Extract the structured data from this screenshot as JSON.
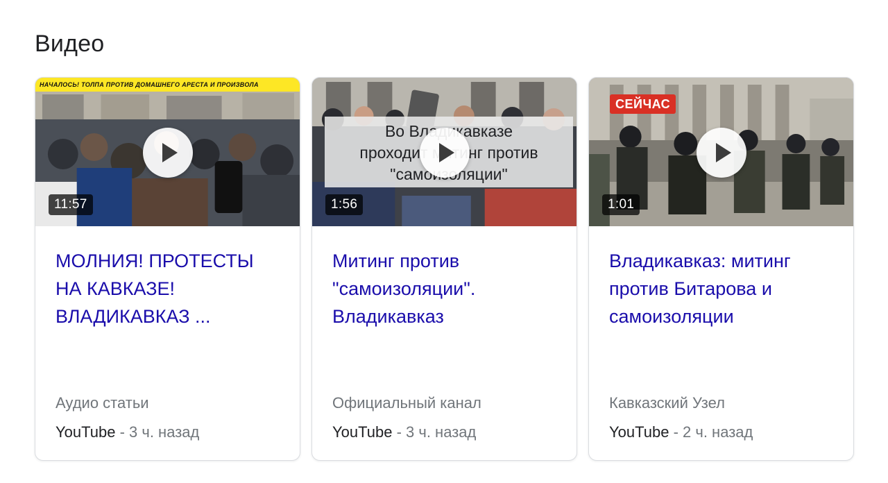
{
  "section": {
    "title": "Видео"
  },
  "videos": [
    {
      "duration": "11:57",
      "banner_text": "НАЧАЛОСЬ! ТОЛПА ПРОТИВ ДОМАШНЕГО АРЕСТА И ПРОИЗВОЛА",
      "title_lines": [
        "МОЛНИЯ! ПРОТЕСТЫ",
        "НА КАВКАЗЕ!",
        "ВЛАДИКАВКАЗ ..."
      ],
      "source": "Аудио статьи",
      "platform": "YouTube",
      "separator": " - ",
      "age": "3 ч. назад"
    },
    {
      "duration": "1:56",
      "overlay_lines": [
        "Во Владикавказе",
        "проходит митинг против",
        "\"самоизоляции\""
      ],
      "title_lines": [
        "Митинг против",
        "\"самоизоляции\".",
        "Владикавказ"
      ],
      "source": "Официальный канал",
      "platform": "YouTube",
      "separator": " - ",
      "age": "3 ч. назад"
    },
    {
      "duration": "1:01",
      "live_badge": "СЕЙЧАС",
      "title_lines": [
        "Владикавказ: митинг",
        "против Битарова и",
        "самоизоляции"
      ],
      "source": "Кавказский Узел",
      "platform": "YouTube",
      "separator": " - ",
      "age": "2 ч. назад"
    }
  ],
  "colors": {
    "title_link": "#1a0dab",
    "muted": "#70757a",
    "live_badge": "#d93025",
    "banner": "#fde725"
  },
  "icons": {
    "play": "play-icon"
  }
}
